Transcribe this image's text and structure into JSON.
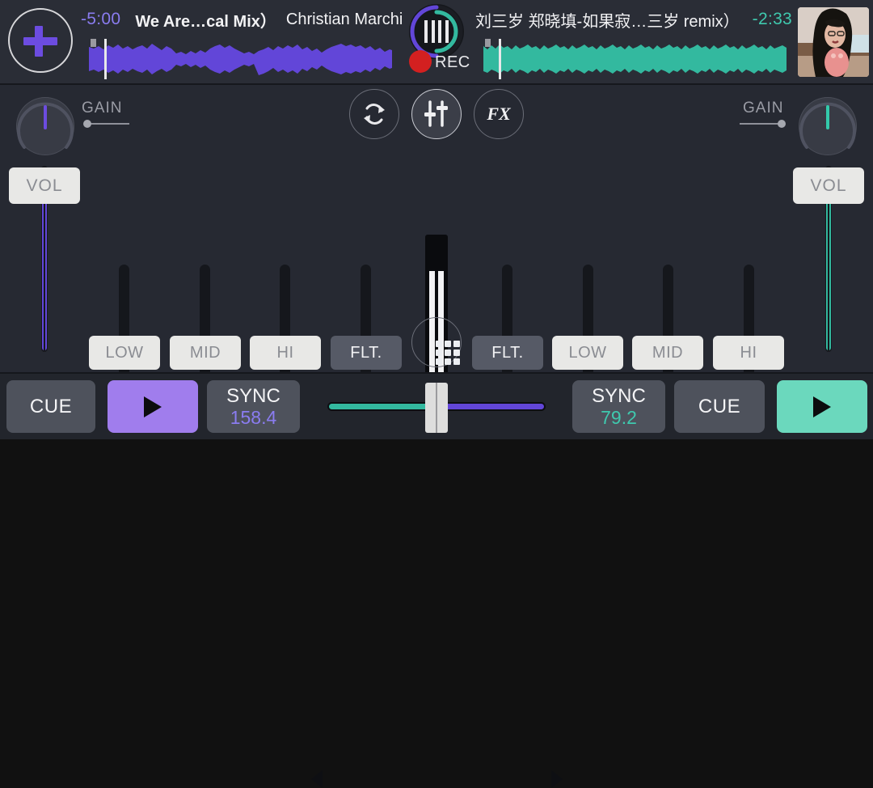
{
  "app": {
    "name": "dj-mixer",
    "colors": {
      "deck_a_accent": "#6246d8",
      "deck_b_accent": "#33b99f",
      "background": "#262932",
      "topbar_background": "#2a2d36",
      "rec_dot": "#d32020",
      "button_light": "#e8e8e6",
      "button_dark": "#565a66"
    }
  },
  "topbar": {
    "add_button": {
      "name": "add-track-button",
      "icon": "plus-icon"
    },
    "deck_a": {
      "time_remaining": "-5:00",
      "track_title": "We Are…cal Mix）",
      "track_artist": "Christian Marchi",
      "waveform_color": "#6246d8"
    },
    "deck_b": {
      "time_remaining": "-2:33",
      "track_title": "刘三岁  郑晓填-如果寂…三岁 remix）",
      "track_artist": "",
      "waveform_color": "#33b99f"
    },
    "vu_meter": {
      "name": "vu-meter",
      "left_arc_color": "#6246d8",
      "right_arc_color": "#33b99f"
    },
    "record": {
      "label": "REC",
      "icon": "record-dot-icon",
      "active": false
    },
    "avatar": {
      "name": "user-avatar"
    }
  },
  "mixer": {
    "deck_a": {
      "gain": {
        "label": "GAIN",
        "value_pct": 0
      },
      "knob": {
        "name": "gain-knob-a",
        "indicator_color": "#6c4ce0"
      },
      "volume": {
        "label": "VOL",
        "position_pct": 100
      },
      "eq": [
        {
          "label": "LOW",
          "style": "light"
        },
        {
          "label": "MID",
          "style": "light"
        },
        {
          "label": "HI",
          "style": "light"
        },
        {
          "label": "FLT.",
          "style": "dark"
        }
      ]
    },
    "deck_b": {
      "gain": {
        "label": "GAIN",
        "value_pct": 100
      },
      "knob": {
        "name": "gain-knob-b",
        "indicator_color": "#33c9ab"
      },
      "volume": {
        "label": "VOL",
        "position_pct": 100
      },
      "eq": [
        {
          "label": "FLT.",
          "style": "dark"
        },
        {
          "label": "LOW",
          "style": "light"
        },
        {
          "label": "MID",
          "style": "light"
        },
        {
          "label": "HI",
          "style": "light"
        }
      ]
    },
    "center": {
      "loop_button": {
        "name": "loop-button",
        "icon": "loop-arrows-icon",
        "active": false
      },
      "mixer_button": {
        "name": "mixer-button",
        "icon": "sliders-icon",
        "active": true
      },
      "fx_button": {
        "name": "fx-button",
        "label": "FX",
        "active": false
      },
      "pads_button": {
        "name": "pads-button",
        "icon": "grid-3x3-icon"
      },
      "master_fader": {
        "name": "master-fader",
        "position_pct": 78
      }
    }
  },
  "bottom": {
    "deck_a": {
      "cue_label": "CUE",
      "play_icon": "play-triangle-icon",
      "play_active": true,
      "sync_label": "SYNC",
      "bpm": "158.4"
    },
    "deck_b": {
      "cue_label": "CUE",
      "play_icon": "play-triangle-icon",
      "play_active": true,
      "sync_label": "SYNC",
      "bpm": "79.2"
    },
    "crossfader": {
      "name": "crossfader",
      "position_pct": 50,
      "left_color": "#33b99f",
      "right_color": "#6246d8",
      "left_arrow_icon": "triangle-left-icon",
      "right_arrow_icon": "triangle-right-icon"
    }
  }
}
